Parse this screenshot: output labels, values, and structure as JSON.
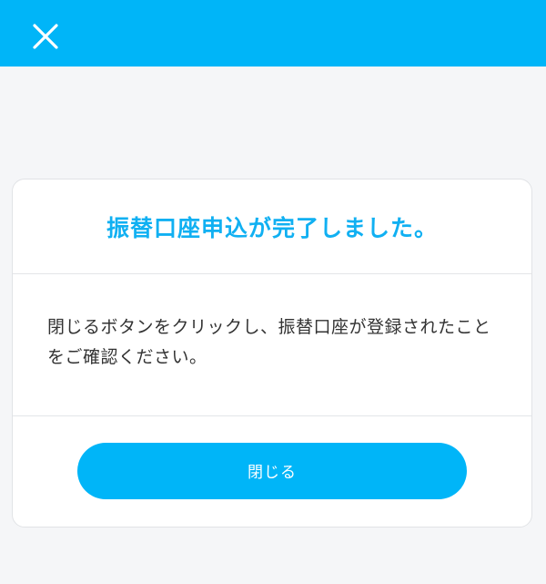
{
  "header": {
    "close_icon": "close-icon",
    "background_color": "#00b5f8"
  },
  "dialog": {
    "title": "振替口座申込が完了しました。",
    "message": "閉じるボタンをクリックし、振替口座が登録されたことをご確認ください。",
    "close_button_label": "閉じる",
    "accent_color": "#10b0f2"
  }
}
